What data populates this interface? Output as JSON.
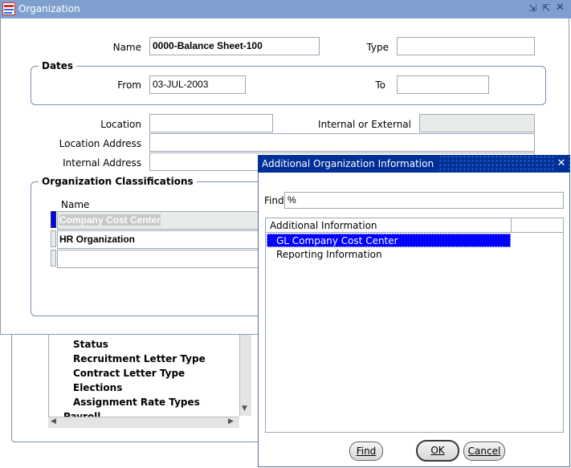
{
  "org_window": {
    "title": "Organization",
    "name_label": "Name",
    "name_value": "0000-Balance Sheet-100",
    "type_label": "Type",
    "type_value": "",
    "dates_legend": "Dates",
    "from_label": "From",
    "from_value": "03-JUL-2003",
    "to_label": "To",
    "to_value": "",
    "location_label": "Location",
    "location_value": "",
    "internal_external_label": "Internal or External",
    "location_address_label": "Location Address",
    "internal_address_label": "Internal Address",
    "classifications_legend": "Organization Classifications",
    "class_name_header": "Name",
    "classifications": [
      "Company Cost Center",
      "HR Organization",
      ""
    ]
  },
  "bg_list": {
    "items": [
      "Status",
      "Recruitment Letter Type",
      "Contract Letter Type",
      "Elections",
      "Assignment Rate Types"
    ],
    "partial_item": "Payroll"
  },
  "dialog": {
    "title": "Additional Organization Information",
    "find_label": "Find",
    "find_value": "%",
    "list_header": "Additional Information",
    "items": [
      "GL Company Cost Center",
      "Reporting Information"
    ],
    "selected_index": 0,
    "find_button": "Find",
    "ok_button": "OK",
    "cancel_button": "Cancel"
  },
  "colors": {
    "title_bar": "#7fa0cf",
    "dialog_title": "#002f97",
    "selection": "#0000ff",
    "read_only": "#e7ece9"
  }
}
